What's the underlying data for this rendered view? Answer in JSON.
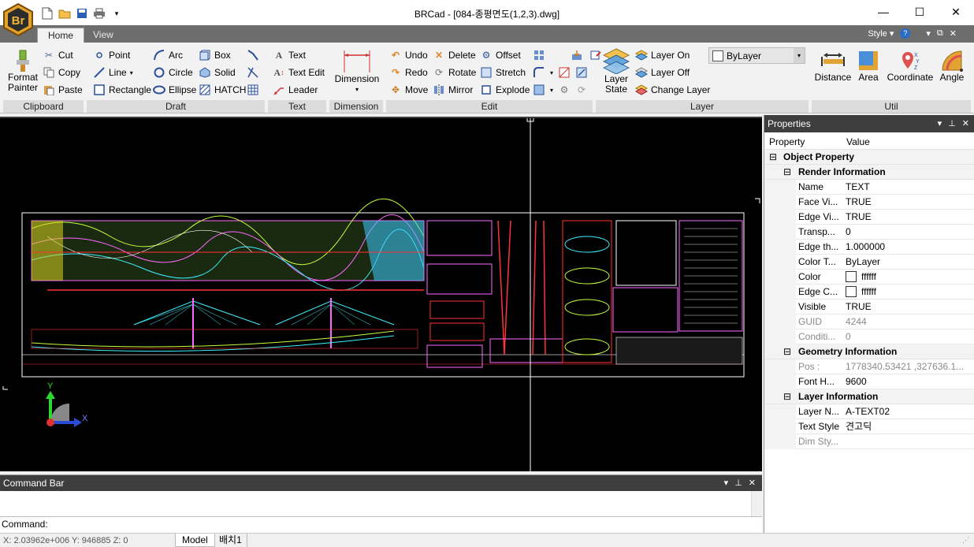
{
  "app": {
    "logo": "Br",
    "title": "BRCad - [084-종평면도(1,2,3).dwg]"
  },
  "qat": [
    "new-file-icon",
    "open-folder-icon",
    "save-icon",
    "print-icon",
    "qat-dropdown-icon"
  ],
  "window_buttons": {
    "minimize": "—",
    "maximize": "☐",
    "close": "✕"
  },
  "tabs": [
    "Home",
    "View"
  ],
  "style_menu": {
    "label": "Style",
    "help": "?"
  },
  "ribbon": {
    "clipboard": {
      "format_painter": "Format\nPainter",
      "cut": "Cut",
      "copy": "Copy",
      "paste": "Paste",
      "group": "Clipboard"
    },
    "draft": {
      "point": "Point",
      "line": "Line",
      "rectangle": "Rectangle",
      "arc": "Arc",
      "circle": "Circle",
      "ellipse": "Ellipse",
      "box": "Box",
      "solid": "Solid",
      "hatch": "HATCH",
      "group": "Draft"
    },
    "text": {
      "text": "Text",
      "text_edit": "Text Edit",
      "leader": "Leader",
      "group": "Text"
    },
    "dimension": {
      "dimension": "Dimension",
      "group": "Dimension"
    },
    "edit": {
      "undo": "Undo",
      "redo": "Redo",
      "move": "Move",
      "delete": "Delete",
      "rotate": "Rotate",
      "mirror": "Mirror",
      "offset": "Offset",
      "stretch": "Stretch",
      "explode": "Explode",
      "group": "Edit"
    },
    "layer": {
      "layer_state": "Layer\nState",
      "layer_on": "Layer On",
      "layer_off": "Layer Off",
      "change_layer": "Change Layer",
      "bylayer": "ByLayer",
      "group": "Layer"
    },
    "util": {
      "distance": "Distance",
      "area": "Area",
      "coordinate": "Coordinate",
      "angle": "Angle",
      "group": "Util"
    }
  },
  "properties": {
    "title": "Properties",
    "col_property": "Property",
    "col_value": "Value",
    "object_property": "Object Property",
    "render_info": "Render Information",
    "render_rows": [
      {
        "k": "Name",
        "v": "TEXT"
      },
      {
        "k": "Face Vi...",
        "v": "TRUE"
      },
      {
        "k": "Edge Vi...",
        "v": "TRUE"
      },
      {
        "k": "Transp...",
        "v": "0"
      },
      {
        "k": "Edge th...",
        "v": "1.000000"
      },
      {
        "k": "Color T...",
        "v": "ByLayer"
      },
      {
        "k": "Color",
        "v": "ffffff"
      },
      {
        "k": "Edge C...",
        "v": "ffffff"
      },
      {
        "k": "Visible",
        "v": "TRUE"
      },
      {
        "k": "GUID",
        "v": "4244"
      },
      {
        "k": "Conditi...",
        "v": "0"
      }
    ],
    "geometry_info": "Geometry Information",
    "geometry_rows": [
      {
        "k": "Pos :",
        "v": "1778340.53421 ,327636.1..."
      },
      {
        "k": "Font H...",
        "v": "9600"
      }
    ],
    "layer_info": "Layer Information",
    "layer_rows": [
      {
        "k": "Layer N...",
        "v": "A-TEXT02"
      },
      {
        "k": "Text Style",
        "v": "견고딕"
      },
      {
        "k": "Dim Sty...",
        "v": ""
      }
    ]
  },
  "command_bar": {
    "title": "Command Bar",
    "prompt": "Command:"
  },
  "status": {
    "coords": "X: 2.03962e+006  Y: 946885  Z: 0",
    "tab_model": "Model",
    "tab_layout": "배치1"
  },
  "colors": {
    "canvas": "#000000",
    "panel_title": "#3e3e3e",
    "accent": "#2b6cc4"
  }
}
